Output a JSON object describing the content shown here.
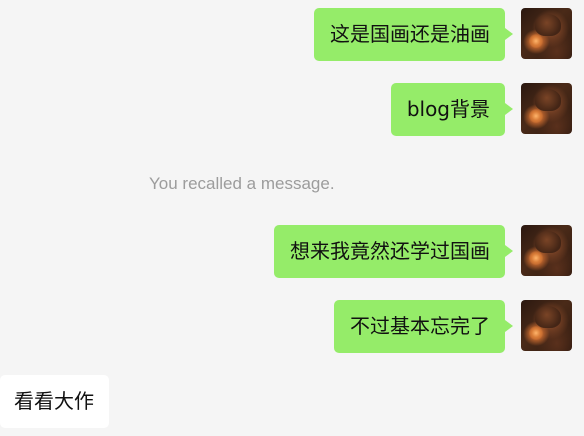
{
  "chat": {
    "messages": [
      {
        "direction": "out",
        "type": "text",
        "text": "这是国画还是油画",
        "avatar_icon": "user-avatar"
      },
      {
        "direction": "out",
        "type": "text",
        "text": "blog背景",
        "avatar_icon": "user-avatar"
      },
      {
        "type": "system",
        "text": "You recalled a message."
      },
      {
        "direction": "out",
        "type": "text",
        "text": "想来我竟然还学过国画",
        "avatar_icon": "user-avatar"
      },
      {
        "direction": "out",
        "type": "text",
        "text": "不过基本忘完了",
        "avatar_icon": "user-avatar"
      },
      {
        "direction": "in",
        "type": "text",
        "text": "看看大作"
      }
    ]
  },
  "colors": {
    "background": "#f5f5f5",
    "outgoing_bubble": "#95ec69",
    "incoming_bubble": "#ffffff",
    "message_text": "#111111",
    "system_text": "#9c9c9c"
  }
}
